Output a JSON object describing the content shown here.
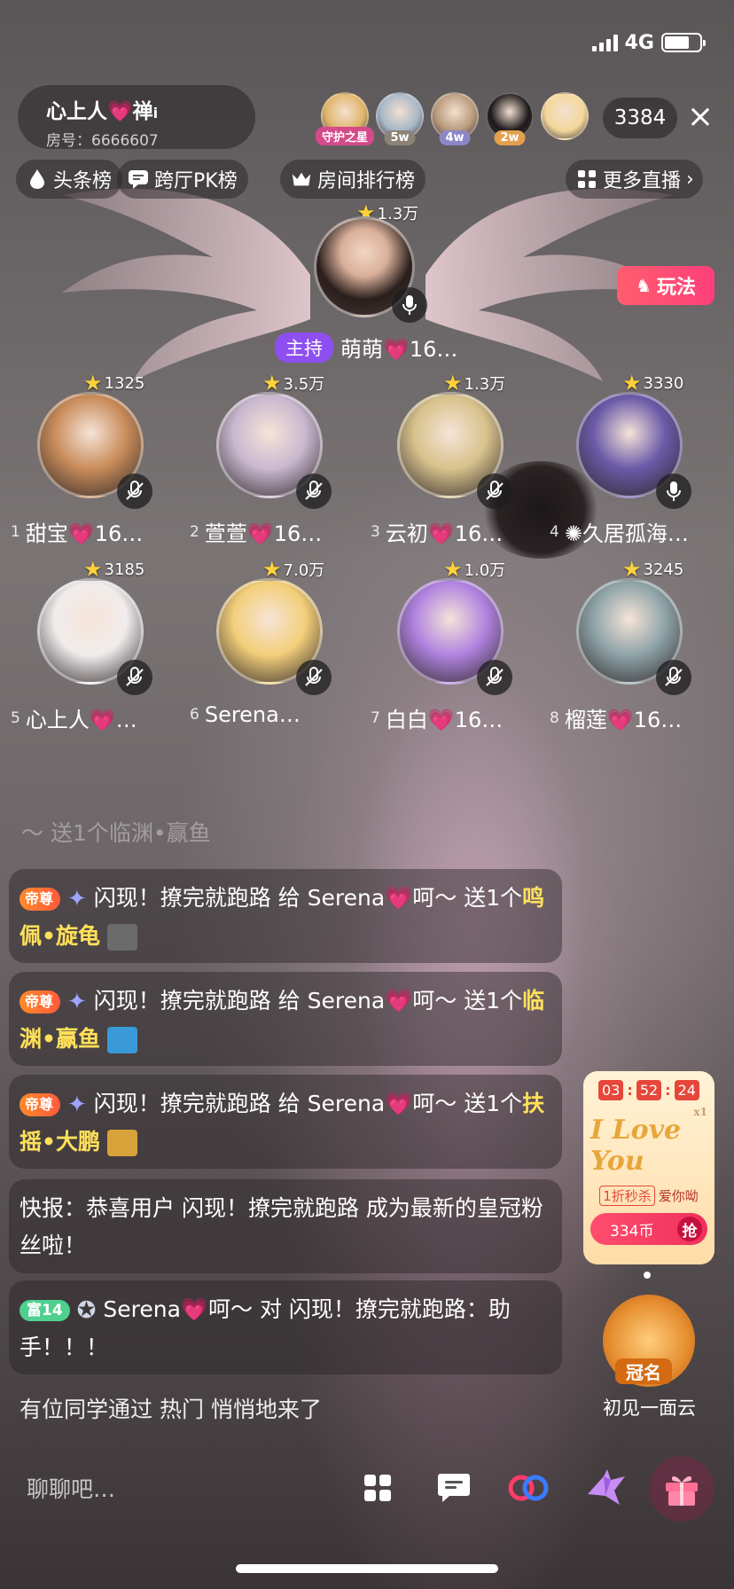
{
  "status_bar": {
    "network": "4G"
  },
  "room": {
    "name": "心上人💗禅",
    "name_suffix": "i",
    "id_label": "房号：6666607"
  },
  "top_audience": [
    {
      "tag": "守护之星",
      "tag_color": "#d44a8a",
      "avatar_color": "#e0b56a"
    },
    {
      "tag": "5w",
      "tag_color": "#8c8376",
      "avatar_color": "#a7b7c7"
    },
    {
      "tag": "4w",
      "tag_color": "#8c86c8",
      "avatar_color": "#b99a7c"
    },
    {
      "tag": "2w",
      "tag_color": "#e3a04f",
      "avatar_color": "#1e1a1c"
    },
    {
      "tag": "",
      "tag_color": "#ffffff",
      "avatar_color": "#f4d79a"
    }
  ],
  "audience_count": "3384",
  "rank_tabs": [
    {
      "label": "头条榜",
      "icon": "drop-icon"
    },
    {
      "label": "跨厅PK榜",
      "icon": "chat-bubble-icon"
    },
    {
      "label": "房间排行榜",
      "icon": "crown-icon"
    }
  ],
  "more_live": {
    "label": "更多直播",
    "icon": "grid-icon"
  },
  "play_button": {
    "label": "玩法"
  },
  "host": {
    "score": "1.3万",
    "tag": "主持",
    "name": "萌萌💗16…"
  },
  "seats": [
    {
      "num": "1",
      "name": "甜宝💗16…",
      "score": "1325",
      "avatar_color": "#c98c5a",
      "mic": "muted"
    },
    {
      "num": "2",
      "name": "萱萱💗16…",
      "score": "3.5万",
      "avatar_color": "#c9b8cf",
      "mic": "muted"
    },
    {
      "num": "3",
      "name": "云初💗16…",
      "score": "1.3万",
      "avatar_color": "#d8c28c",
      "mic": "muted"
    },
    {
      "num": "4",
      "name": "✺久居孤海…",
      "score": "3330",
      "avatar_color": "#6a5aa8",
      "mic": "on"
    },
    {
      "num": "5",
      "name": "心上人💗…",
      "score": "3185",
      "avatar_color": "#f0ecec",
      "mic": "muted"
    },
    {
      "num": "6",
      "name": "Serena…",
      "score": "7.0万",
      "avatar_color": "#f3cf7a",
      "mic": "muted"
    },
    {
      "num": "7",
      "name": "白白💗16…",
      "score": "1.0万",
      "avatar_color": "#b183e0",
      "mic": "muted"
    },
    {
      "num": "8",
      "name": "榴莲💗16…",
      "score": "3245",
      "avatar_color": "#8fa4a8",
      "mic": "muted"
    }
  ],
  "chat": {
    "faded_line": "～ 送1个临渊•赢鱼",
    "gift_messages": [
      {
        "badge": "帝尊",
        "text": "闪现！撩完就跑路 给 Serena💗呵～ 送1个",
        "gift": "鸣佩•旋龟",
        "gift_color": "#6b6b6b"
      },
      {
        "badge": "帝尊",
        "text": "闪现！撩完就跑路 给 Serena💗呵～ 送1个",
        "gift": "临渊•赢鱼",
        "gift_color": "#3a9ad8"
      },
      {
        "badge": "帝尊",
        "text": "闪现！撩完就跑路 给 Serena💗呵～ 送1个",
        "gift": "扶摇•大鹏",
        "gift_color": "#d8a23a"
      }
    ],
    "news": "快报：恭喜用户 闪现！撩完就跑路 成为最新的皇冠粉丝啦！",
    "reply": {
      "fan_badge": "富14",
      "text": "Serena💗呵～ 对 闪现！撩完就跑路：助手！！！"
    },
    "system": "有位同学通过 热门 悄悄地来了"
  },
  "promo": {
    "timer": [
      "03",
      "52",
      "24"
    ],
    "art_text": "I Love You",
    "multiplier": "x1",
    "flash_label": "1折秒杀",
    "item_name": "爱你呦",
    "price": "334币",
    "grab_label": "抢"
  },
  "crown": {
    "tag": "冠名",
    "name": "初见一面云"
  },
  "input": {
    "placeholder": "聊聊吧…"
  },
  "colors": {
    "accent_pink": "#ff4fa8",
    "host_purple": "#8e4ff0",
    "gold": "#ffd23a",
    "gift_yellow": "#ffe05a"
  }
}
